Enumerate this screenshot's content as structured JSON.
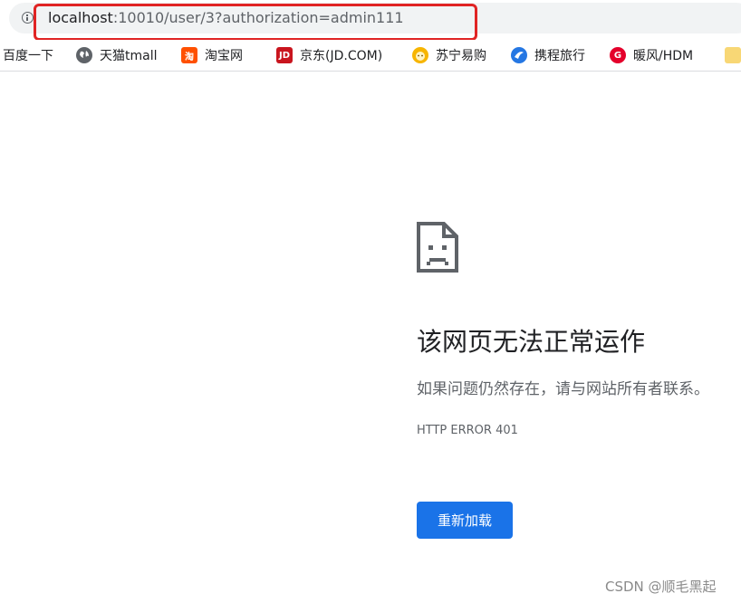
{
  "address_bar": {
    "url_host": "localhost",
    "url_rest": ":10010/user/3?authorization=admin111",
    "info_icon": "info-icon"
  },
  "bookmarks": [
    {
      "label": "百度一下",
      "icon": "none"
    },
    {
      "label": "天猫tmall",
      "icon": "globe-icon"
    },
    {
      "label": "淘宝网",
      "icon": "taobao-icon",
      "icon_text": "淘"
    },
    {
      "label": "京东(JD.COM)",
      "icon": "jd-icon",
      "icon_text": "JD"
    },
    {
      "label": "苏宁易购",
      "icon": "suning-icon"
    },
    {
      "label": "携程旅行",
      "icon": "ctrip-icon"
    },
    {
      "label": "暖风/HDM",
      "icon": "hdm-icon",
      "icon_text": "G"
    },
    {
      "label": "",
      "icon": "folder-icon"
    }
  ],
  "error_page": {
    "icon": "sad-page-icon",
    "title": "该网页无法正常运作",
    "description": "如果问题仍然存在，请与网站所有者联系。",
    "code": "HTTP ERROR 401",
    "reload_label": "重新加载"
  },
  "watermark": "CSDN @顺毛黑起",
  "colors": {
    "button_blue": "#1a73e8",
    "highlight_red": "#e02424",
    "omnibox_bg": "#f1f3f4"
  }
}
